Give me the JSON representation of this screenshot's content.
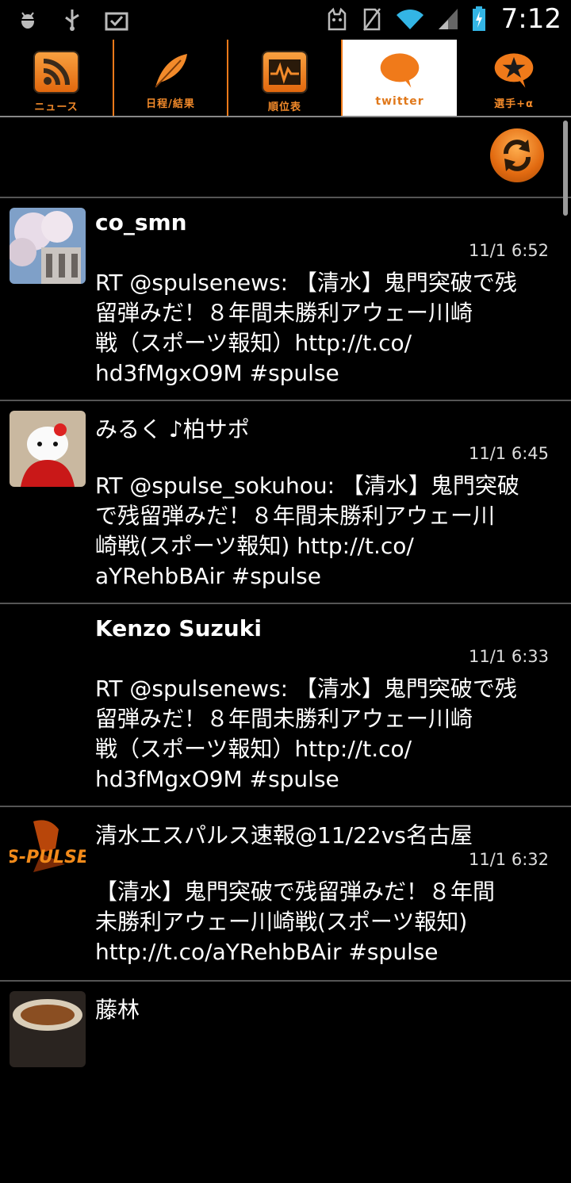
{
  "status_bar": {
    "time": "7:12",
    "icons_left": [
      "android-debug-icon",
      "usb-icon",
      "download-done-icon"
    ],
    "icons_right": [
      "cat-icon",
      "no-sim-icon",
      "wifi-icon",
      "signal-icon",
      "battery-charging-icon"
    ]
  },
  "tabs": [
    {
      "label": "ニュース",
      "icon": "rss-icon",
      "active": false
    },
    {
      "label": "日程/結果",
      "icon": "feather-icon",
      "active": false
    },
    {
      "label": "順位表",
      "icon": "pulse-chart-icon",
      "active": false
    },
    {
      "label": "twitter",
      "icon": "speech-bubble-icon",
      "active": true
    },
    {
      "label": "選手+α",
      "icon": "star-bubble-icon",
      "active": false
    }
  ],
  "colors": {
    "accent": "#f07a1a",
    "background": "#000000",
    "divider": "#555555"
  },
  "tweets": [
    {
      "user": "co_smn",
      "time": "11/1 6:52",
      "lines": [
        "RT @spulsenews: 【清水】鬼門突破で残",
        "留弾みだ！８年間未勝利アウェー川崎",
        "戦（スポーツ報知）http://t.co/",
        "hd3fMgxO9M #spulse"
      ],
      "avatar": "cherry-blossom-avatar"
    },
    {
      "user": "みるく ♪柏サポ",
      "time": "11/1 6:45",
      "lines": [
        "RT @spulse_sokuhou: 【清水】鬼門突破",
        "で残留弾みだ！８年間未勝利アウェー川",
        "崎戦(スポーツ報知) http://t.co/",
        "aYRehbBAir #spulse"
      ],
      "avatar": "hello-kitty-avatar"
    },
    {
      "user": "Kenzo Suzuki",
      "time": "11/1 6:33",
      "lines": [
        "RT @spulsenews: 【清水】鬼門突破で残",
        "留弾みだ！８年間未勝利アウェー川崎",
        "戦（スポーツ報知）http://t.co/",
        "hd3fMgxO9M #spulse"
      ],
      "avatar": "none"
    },
    {
      "user": "清水エスパルス速報@11/22vs名古屋",
      "time": "11/1 6:32",
      "lines": [
        "【清水】鬼門突破で残留弾みだ！８年間",
        "未勝利アウェー川崎戦(スポーツ報知)",
        "http://t.co/aYRehbBAir #spulse"
      ],
      "avatar": "spulse-logo-avatar",
      "avatar_text": "S-PULSE"
    },
    {
      "user": "藤林",
      "time": "",
      "lines": [],
      "avatar": "food-avatar"
    }
  ]
}
